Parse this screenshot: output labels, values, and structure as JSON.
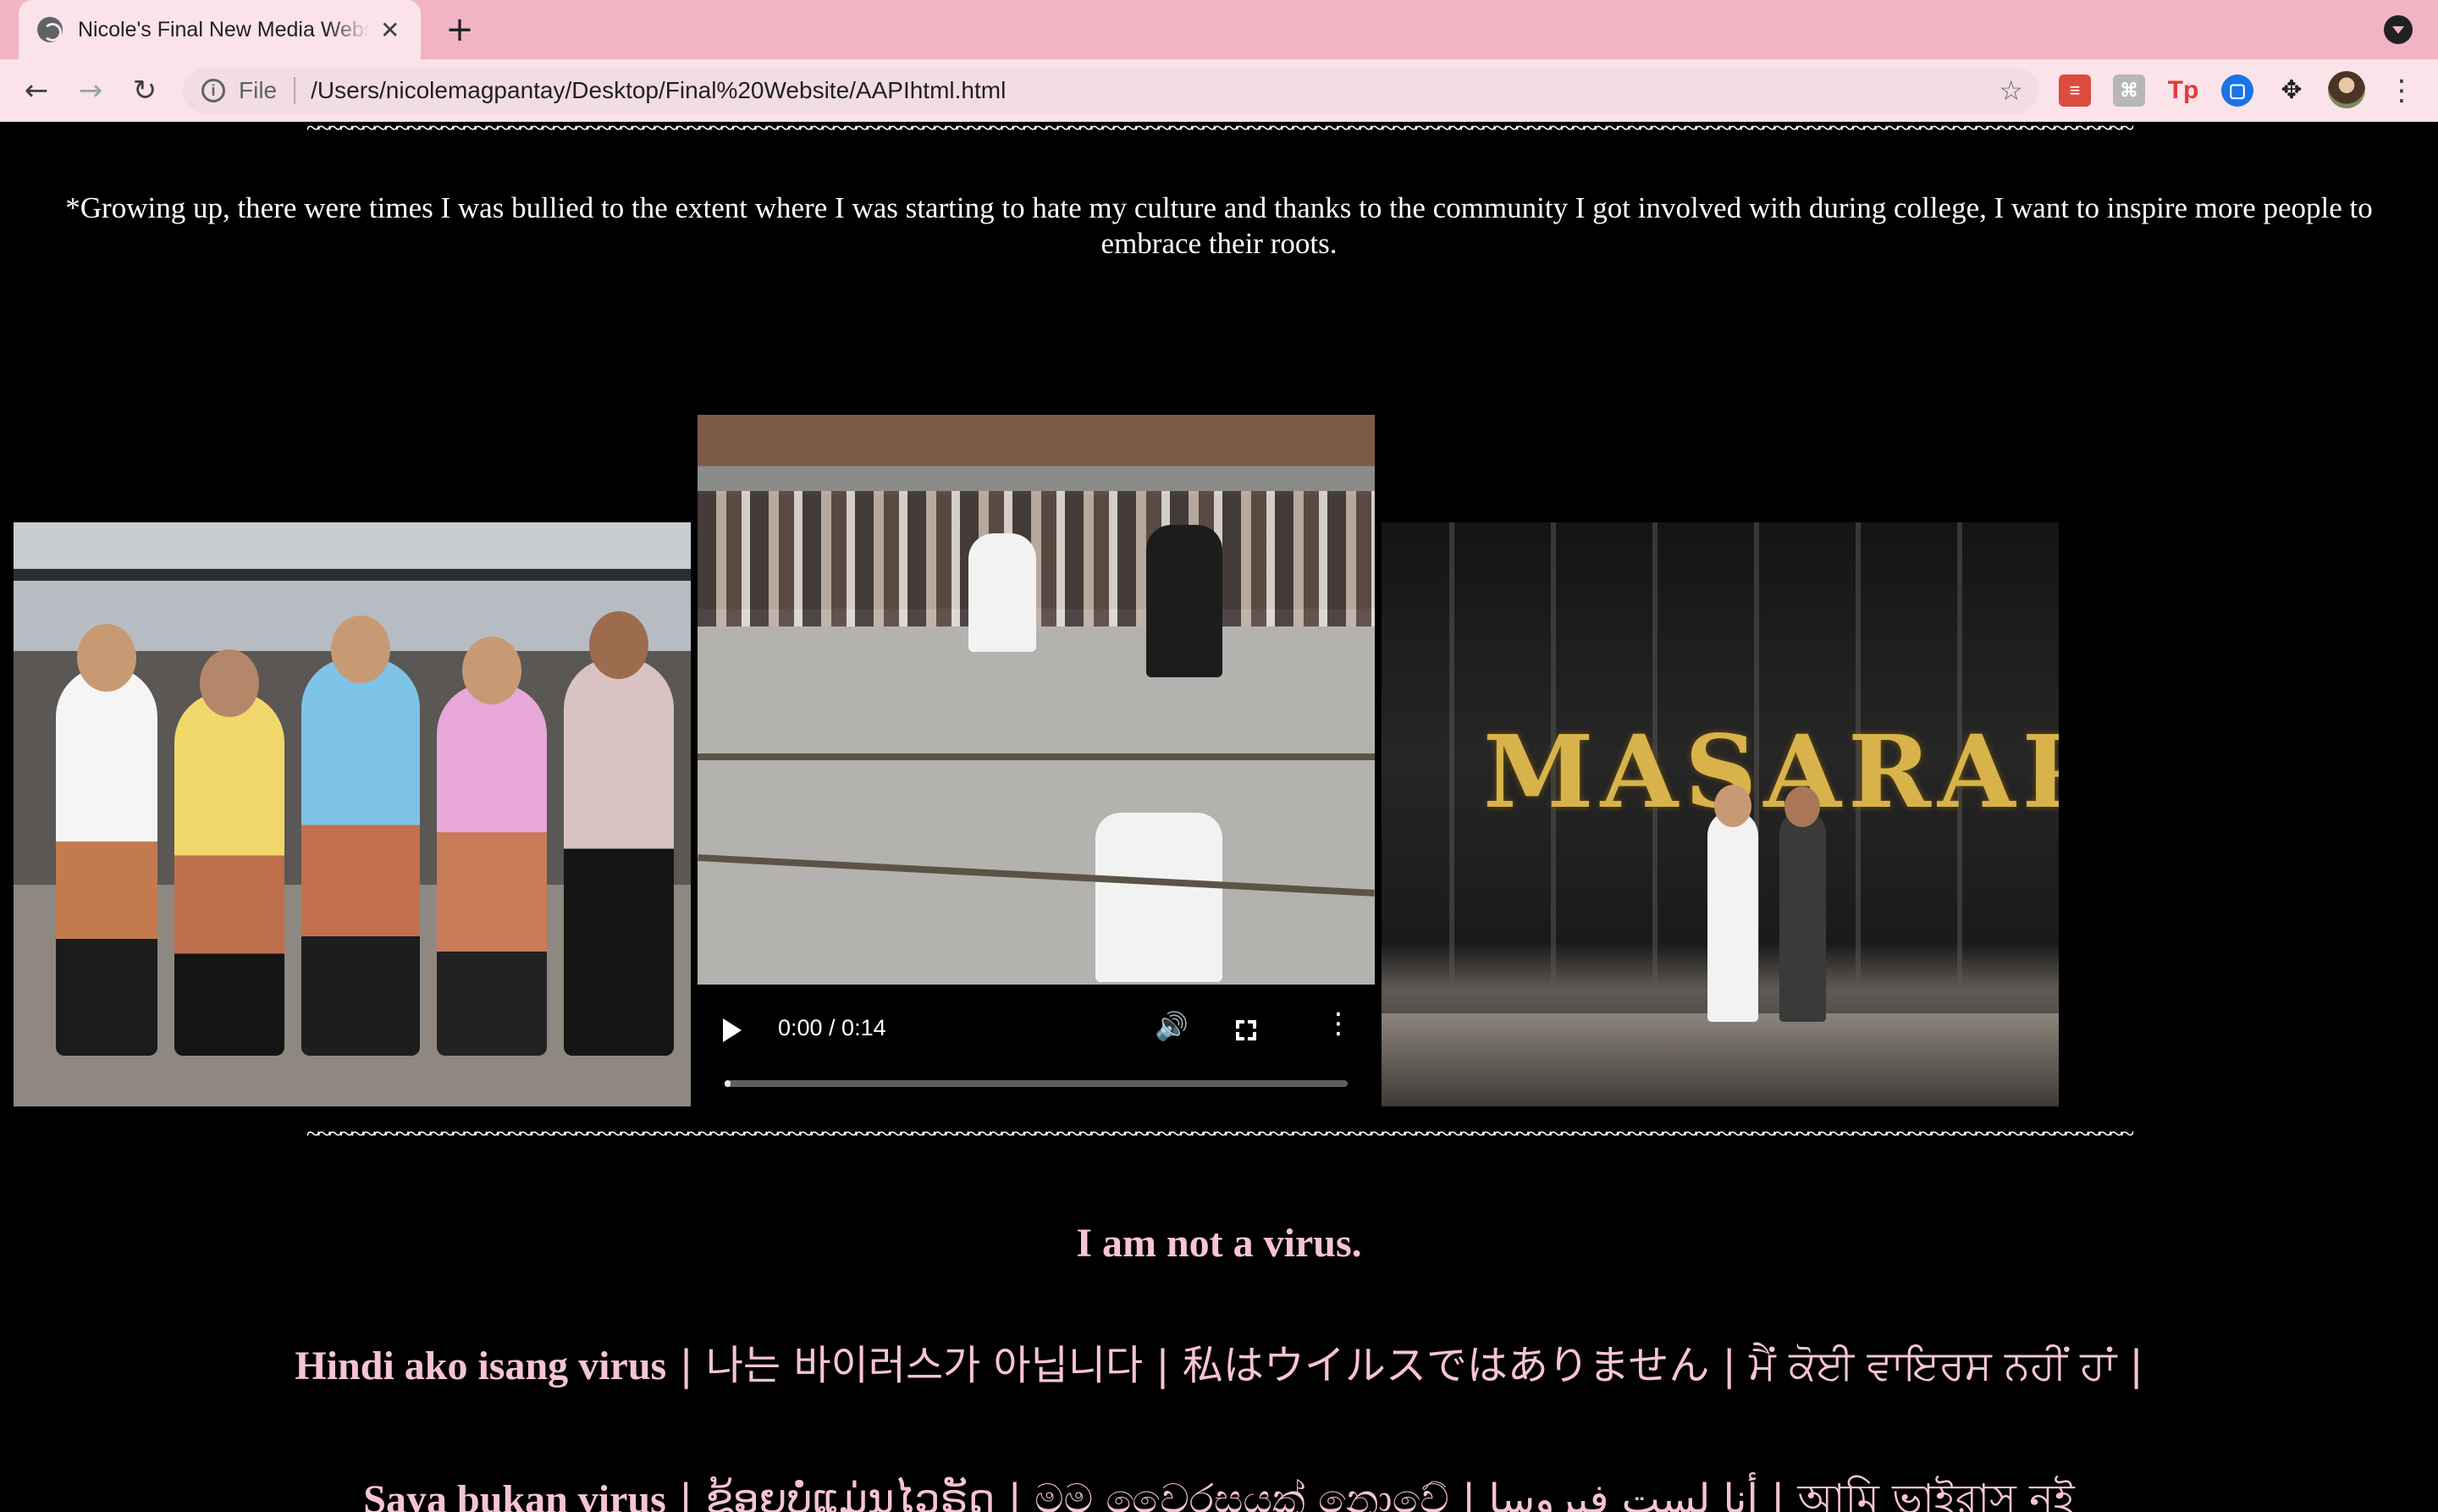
{
  "browser": {
    "tab": {
      "title": "Nicole's Final New Media Website"
    },
    "address": {
      "scheme": "File",
      "url": "/Users/nicolemagpantay/Desktop/Final%20Website/AAPIhtml.html"
    },
    "icons": {
      "back": "arrow-back-icon",
      "forward": "arrow-forward-icon",
      "reload": "reload-icon",
      "star": "bookmark-star-icon",
      "menu": "kebab-menu-icon"
    },
    "extensions": [
      "todoist",
      "pin",
      "Tp",
      "docs",
      "extensions"
    ]
  },
  "page": {
    "divider": "~~~~~~~~~~~~~~~~~~~~~~~~~~~~~~~~~~~~~~~~~~~~~~~~~~~~~~~~~~~~~~~~~~~~~~~~~~~~~~~~~~~~~~~~~~~~~~~~~~~~~~~~~~~~~~~~~~~~~~~~~~~~~~~~~~~~~~~~~~~~~~~~~~~~~~~~~~~~~~~~~~~",
    "intro": "*Growing up, there were times I was bullied to the extent where I was starting to hate my culture and thanks to the community I got involved with during college, I want to inspire more people to embrace their roots.",
    "video": {
      "time": "0:00 / 0:14",
      "progress": 0.0
    },
    "right_photo_sign": "MASARAP",
    "headline": "I am not a virus.",
    "line1": {
      "a": "Hindi ako isang virus",
      "b": " | 나는 바이러스가 아닙니다 | 私はウイルスではありません | ਮੈਂ ਕੋਈ ਵਾਇਰਸ ਨਹੀਂ ਹਾਂ |"
    },
    "line2": {
      "a": "Saya bukan virus",
      "b": " | ຂ້ອຍບໍ່ແມ່ນໄວຣັດ | මම වෛරසයක් නොවේ | أنا لست فيروسا | আমি ভাইরাস নই"
    }
  },
  "colors": {
    "tabbar": "#f2b3c4",
    "toolbar": "#fbe3ea",
    "accent_text": "#f6c4d2",
    "page_bg": "#000000"
  }
}
